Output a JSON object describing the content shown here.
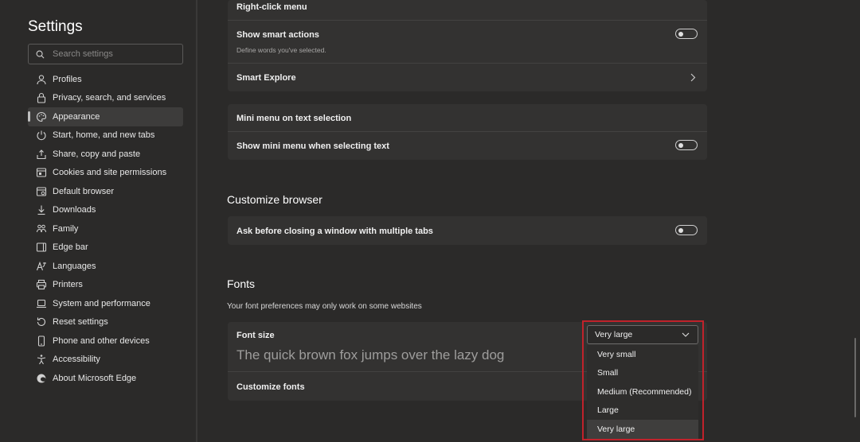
{
  "sidebar": {
    "title": "Settings",
    "search_placeholder": "Search settings",
    "items": [
      {
        "label": "Profiles",
        "icon": "profile-icon"
      },
      {
        "label": "Privacy, search, and services",
        "icon": "lock-icon"
      },
      {
        "label": "Appearance",
        "icon": "palette-icon",
        "active": true
      },
      {
        "label": "Start, home, and new tabs",
        "icon": "power-icon"
      },
      {
        "label": "Share, copy and paste",
        "icon": "share-icon"
      },
      {
        "label": "Cookies and site permissions",
        "icon": "cookies-icon"
      },
      {
        "label": "Default browser",
        "icon": "browser-icon"
      },
      {
        "label": "Downloads",
        "icon": "download-icon"
      },
      {
        "label": "Family",
        "icon": "family-icon"
      },
      {
        "label": "Edge bar",
        "icon": "edge-bar-icon"
      },
      {
        "label": "Languages",
        "icon": "languages-icon"
      },
      {
        "label": "Printers",
        "icon": "printer-icon"
      },
      {
        "label": "System and performance",
        "icon": "laptop-icon"
      },
      {
        "label": "Reset settings",
        "icon": "reset-icon"
      },
      {
        "label": "Phone and other devices",
        "icon": "phone-icon"
      },
      {
        "label": "Accessibility",
        "icon": "accessibility-icon"
      },
      {
        "label": "About Microsoft Edge",
        "icon": "edge-logo-icon"
      }
    ]
  },
  "context_menu": {
    "right_click_menu": "Right-click menu",
    "smart_actions_label": "Show smart actions",
    "smart_actions_desc": "Define words you've selected.",
    "smart_actions_on": false,
    "smart_explore_label": "Smart Explore"
  },
  "mini_menu": {
    "title": "Mini menu on text selection",
    "show_label": "Show mini menu when selecting text",
    "show_on": false
  },
  "customize_browser": {
    "heading": "Customize browser",
    "ask_close_label": "Ask before closing a window with multiple tabs",
    "ask_close_on": false
  },
  "fonts": {
    "heading": "Fonts",
    "description": "Your font preferences may only work on some websites",
    "font_size_label": "Font size",
    "preview": "The quick brown fox jumps over the lazy dog",
    "customize_label": "Customize fonts",
    "font_size_value": "Very large",
    "options": [
      "Very small",
      "Small",
      "Medium (Recommended)",
      "Large",
      "Very large"
    ]
  },
  "colors": {
    "highlight": "#c0222b",
    "background": "#2b2a29",
    "card": "#333231"
  }
}
